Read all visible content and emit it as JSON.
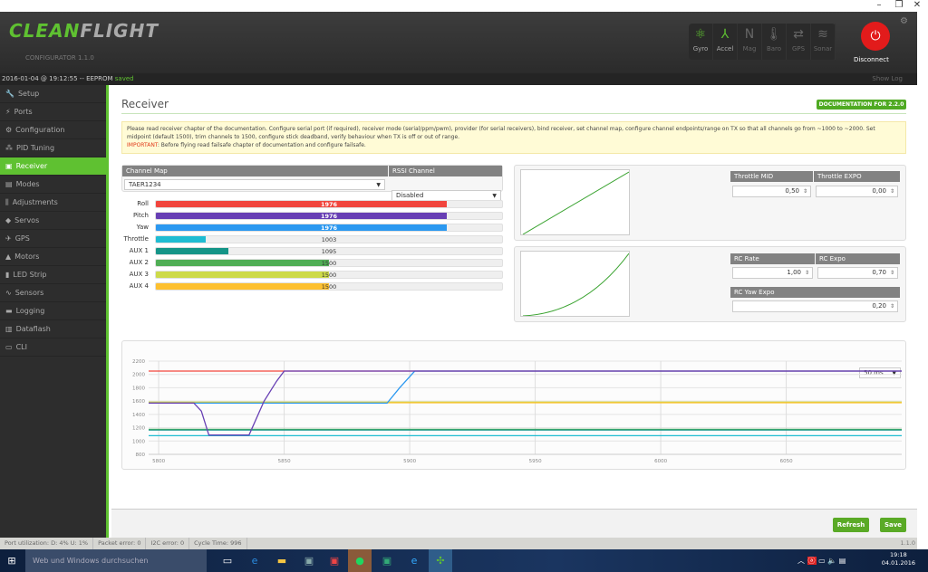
{
  "window": {
    "minimize": "–",
    "restore": "❐",
    "close": "✕"
  },
  "header": {
    "logo_a": "CLEAN",
    "logo_b": "FLIGHT",
    "logo_sub": "CONFIGURATOR  1.1.0",
    "sensors": [
      {
        "label": "Gyro",
        "icon": "gyro-icon",
        "glyph": "⚛",
        "on": true
      },
      {
        "label": "Accel",
        "icon": "accel-icon",
        "glyph": "⅄",
        "on": true
      },
      {
        "label": "Mag",
        "icon": "mag-icon",
        "glyph": "N",
        "on": false
      },
      {
        "label": "Baro",
        "icon": "baro-icon",
        "glyph": "🌡",
        "on": false
      },
      {
        "label": "GPS",
        "icon": "gps-icon",
        "glyph": "⇄",
        "on": false
      },
      {
        "label": "Sonar",
        "icon": "sonar-icon",
        "glyph": "≋",
        "on": false
      }
    ],
    "disconnect": "Disconnect"
  },
  "logbar": {
    "text": "2016-01-04 @ 19:12:55 -- EEPROM ",
    "status": "saved",
    "show_log": "Show Log"
  },
  "sidebar": {
    "items": [
      {
        "label": "Setup",
        "glyph": "🔧"
      },
      {
        "label": "Ports",
        "glyph": "⚡"
      },
      {
        "label": "Configuration",
        "glyph": "⚙"
      },
      {
        "label": "PID Tuning",
        "glyph": "⁂"
      },
      {
        "label": "Receiver",
        "glyph": "▣",
        "active": true
      },
      {
        "label": "Modes",
        "glyph": "▤"
      },
      {
        "label": "Adjustments",
        "glyph": "⫼"
      },
      {
        "label": "Servos",
        "glyph": "◆"
      },
      {
        "label": "GPS",
        "glyph": "✈"
      },
      {
        "label": "Motors",
        "glyph": "▲"
      },
      {
        "label": "LED Strip",
        "glyph": "▮"
      },
      {
        "label": "Sensors",
        "glyph": "∿"
      },
      {
        "label": "Logging",
        "glyph": "▬"
      },
      {
        "label": "Dataflash",
        "glyph": "▥"
      },
      {
        "label": "CLI",
        "glyph": "▭"
      }
    ]
  },
  "main": {
    "title": "Receiver",
    "doc_button": "DOCUMENTATION FOR 2.2.0",
    "note": "Please read receiver chapter of the documentation. Configure serial port (if required), receiver mode (serial/ppm/pwm), provider (for serial receivers), bind receiver, set channel map, configure channel endpoints/range on TX so that all channels go from ~1000 to ~2000. Set midpoint (default 1500), trim channels to 1500, configure stick deadband, verify behaviour when TX is off or out of range.",
    "important_label": "IMPORTANT",
    "important_text": ": Before flying read failsafe chapter of documentation and configure failsafe.",
    "channel_map_label": "Channel Map",
    "channel_map_value": "TAER1234",
    "rssi_label": "RSSI Channel",
    "rssi_value": "Disabled",
    "channels": [
      {
        "name": "Roll",
        "value": "1976",
        "pct": 0.84,
        "color": "#f1453d",
        "light": true
      },
      {
        "name": "Pitch",
        "value": "1976",
        "pct": 0.84,
        "color": "#673fb4",
        "light": true
      },
      {
        "name": "Yaw",
        "value": "1976",
        "pct": 0.84,
        "color": "#2b98f0",
        "light": true
      },
      {
        "name": "Throttle",
        "value": "1003",
        "pct": 0.145,
        "color": "#1fbcd2"
      },
      {
        "name": "AUX 1",
        "value": "1095",
        "pct": 0.21,
        "color": "#159588"
      },
      {
        "name": "AUX 2",
        "value": "1500",
        "pct": 0.5,
        "color": "#50ae55"
      },
      {
        "name": "AUX 3",
        "value": "1500",
        "pct": 0.5,
        "color": "#cdda49"
      },
      {
        "name": "AUX 4",
        "value": "1500",
        "pct": 0.5,
        "color": "#fdc02f"
      }
    ],
    "throttle_mid_label": "Throttle MID",
    "throttle_mid": "0,50",
    "throttle_expo_label": "Throttle EXPO",
    "throttle_expo": "0,00",
    "rc_rate_label": "RC Rate",
    "rc_rate": "1,00",
    "rc_expo_label": "RC Expo",
    "rc_expo": "0,70",
    "rc_yaw_expo_label": "RC Yaw Expo",
    "rc_yaw_expo": "0,20",
    "refresh_rate": "50 ms",
    "refresh": "Refresh",
    "save": "Save"
  },
  "status": {
    "port": "Port utilization: D: 4% U: 1%",
    "packet": "Packet error: 0",
    "i2c": "I2C error: 0",
    "cycle": "Cycle Time: 996",
    "version": "1.1.0"
  },
  "taskbar": {
    "search": "Web und Windows durchsuchen",
    "time": "19:18",
    "date": "04.01.2016"
  },
  "chart_data": {
    "type": "line",
    "xlim": [
      5796,
      6096
    ],
    "ylim": [
      800,
      2200
    ],
    "xticks": [
      "5800",
      "5850",
      "5900",
      "5950",
      "6000",
      "6050"
    ],
    "yticks": [
      "2200",
      "2000",
      "1800",
      "1600",
      "1400",
      "1200",
      "1000",
      "800"
    ],
    "series": [
      {
        "name": "Roll",
        "color": "#f1453d",
        "points": [
          [
            5796,
            2050
          ],
          [
            6096,
            2050
          ]
        ]
      },
      {
        "name": "AUX 3",
        "color": "#cdda49",
        "points": [
          [
            5796,
            1585
          ],
          [
            6096,
            1585
          ]
        ]
      },
      {
        "name": "AUX 4",
        "color": "#fdc02f",
        "points": [
          [
            5796,
            1575
          ],
          [
            6096,
            1575
          ]
        ]
      },
      {
        "name": "AUX 2",
        "color": "#50ae55",
        "points": [
          [
            5796,
            1175
          ],
          [
            6096,
            1175
          ]
        ]
      },
      {
        "name": "AUX 1",
        "color": "#159588",
        "points": [
          [
            5796,
            1165
          ],
          [
            6096,
            1165
          ]
        ]
      },
      {
        "name": "Throttle",
        "color": "#1fbcd2",
        "points": [
          [
            5796,
            1080
          ],
          [
            6096,
            1080
          ]
        ]
      },
      {
        "name": "Yaw",
        "color": "#2b98f0",
        "points": [
          [
            5796,
            1570
          ],
          [
            5891,
            1570
          ],
          [
            5896,
            1800
          ],
          [
            5902,
            2050
          ],
          [
            6096,
            2050
          ]
        ]
      },
      {
        "name": "Pitch",
        "color": "#673fb4",
        "points": [
          [
            5796,
            1570
          ],
          [
            5814,
            1570
          ],
          [
            5817,
            1450
          ],
          [
            5820,
            1090
          ],
          [
            5836,
            1090
          ],
          [
            5842,
            1600
          ],
          [
            5847,
            1900
          ],
          [
            5850,
            2050
          ],
          [
            6096,
            2050
          ]
        ]
      }
    ]
  }
}
